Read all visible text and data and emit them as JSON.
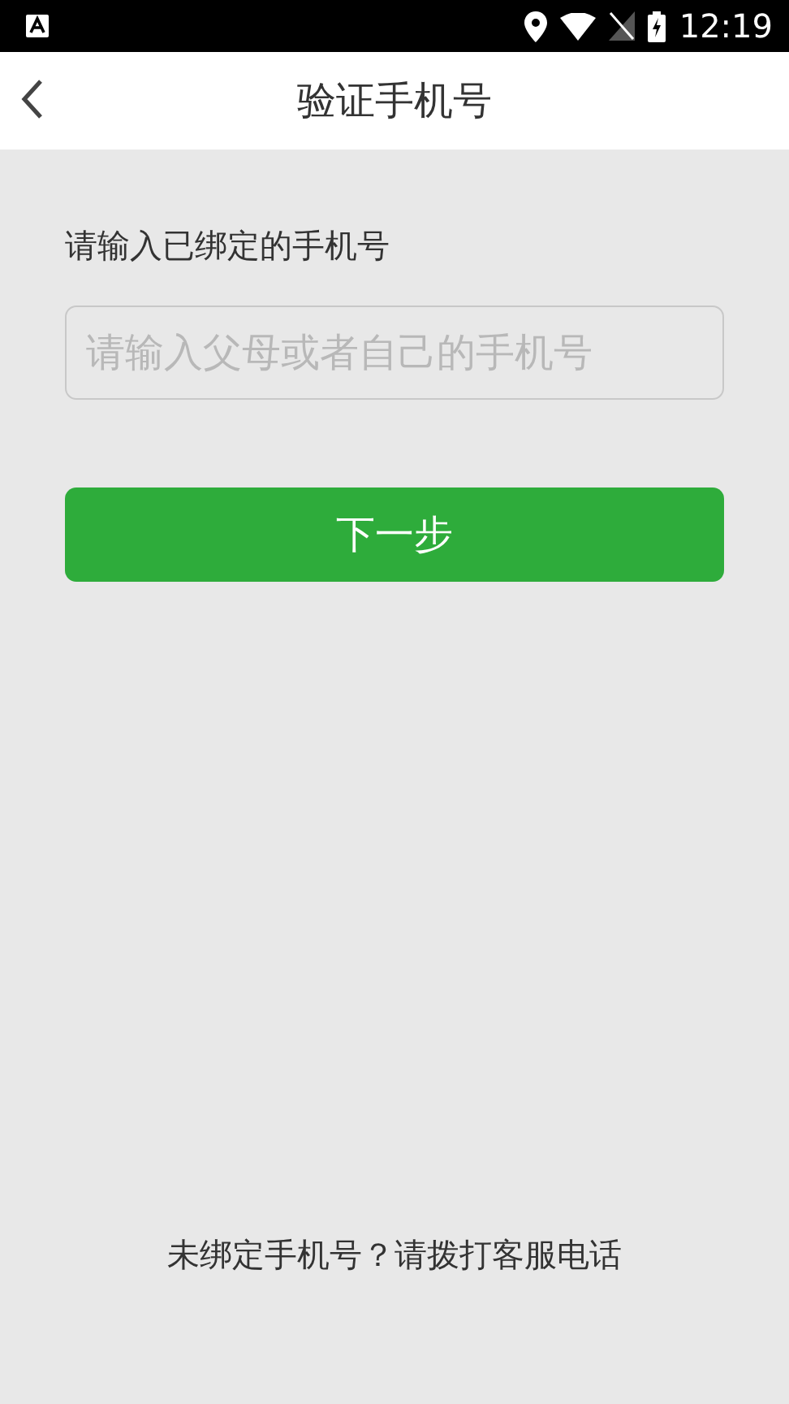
{
  "status_bar": {
    "time": "12:19"
  },
  "header": {
    "title": "验证手机号"
  },
  "form": {
    "label": "请输入已绑定的手机号",
    "phone_field": {
      "placeholder": "请输入父母或者自己的手机号"
    },
    "next_button": "下一步"
  },
  "footer": {
    "help_text": "未绑定手机号？请拨打客服电话"
  }
}
